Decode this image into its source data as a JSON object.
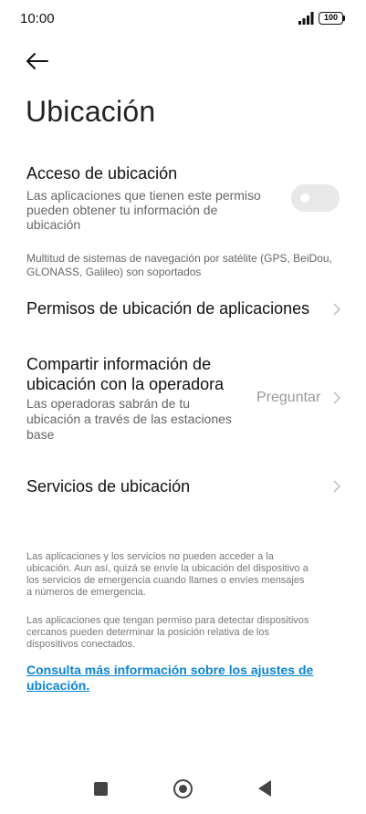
{
  "status_bar": {
    "time": "10:00",
    "battery": "100"
  },
  "header": {
    "title": "Ubicación",
    "back_icon": "arrow-left-icon"
  },
  "location_access": {
    "title": "Acceso de ubicación",
    "description_line1": "Las aplicaciones que tienen este permiso",
    "description_line2": "pueden obtener tu información de",
    "description_line3": "ubicación",
    "enabled": false
  },
  "gnss_note": "Multitud de sistemas de navegación por satélite (GPS, BeiDou, GLONASS, Galileo) son soportados",
  "app_permissions": {
    "title": "Permisos de ubicación de aplicaciones"
  },
  "carrier_sharing": {
    "title_line1": "Compartir información de",
    "title_line2": "ubicación con la operadora",
    "description_line1": "Las operadoras sabrán de tu",
    "description_line2": "ubicación a través de las estaciones",
    "description_line3": "base",
    "value": "Preguntar"
  },
  "location_services": {
    "title": "Servicios de ubicación"
  },
  "footer": {
    "note1_line1": "Las aplicaciones y los servicios no pueden acceder a la",
    "note1_line2": "ubicación. Aun así, quizá se envíe la ubicación del dispositivo a",
    "note1_line3": "los servicios de emergencia cuando llames o envíes mensajes",
    "note1_line4": "a números de emergencia.",
    "note2_line1": "Las aplicaciones que tengan permiso para detectar dispositivos",
    "note2_line2": "cercanos pueden determinar la posición relativa de los",
    "note2_line3": "dispositivos conectados.",
    "link_line1": "Consulta más información sobre los ajustes de",
    "link_line2": "ubicación."
  },
  "colors": {
    "accent_link": "#0a84d6",
    "toggle_off": "#e8e8e8"
  }
}
